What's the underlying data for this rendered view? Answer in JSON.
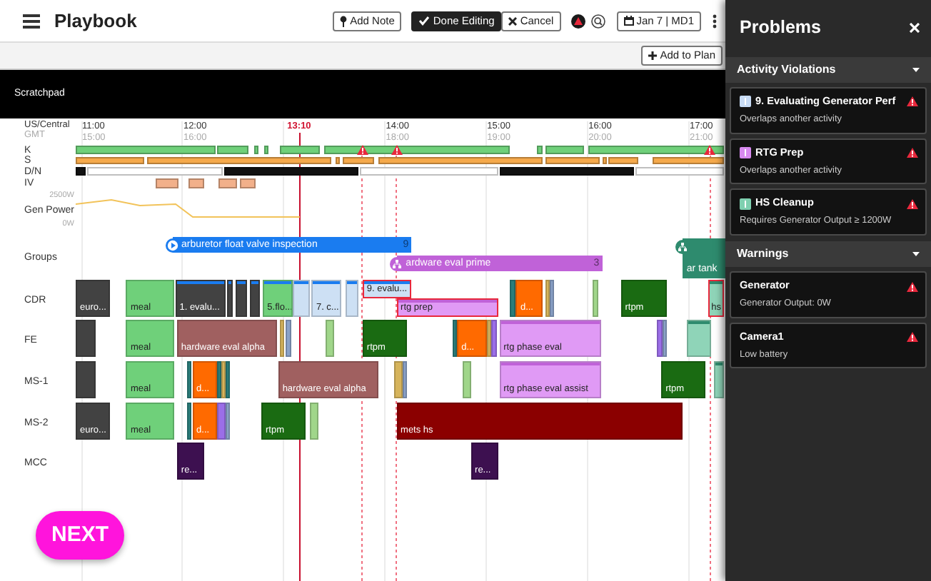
{
  "header": {
    "title": "Playbook",
    "actions": [
      {
        "kind": "note",
        "label": "Add Note"
      },
      {
        "kind": "done",
        "label": "Done Editing"
      },
      {
        "kind": "cancel",
        "label": "Cancel"
      }
    ],
    "date": "Jan 7 | MD1"
  },
  "toolbar": {
    "add_button": "Add to Plan"
  },
  "scratchpad": {
    "label": "Scratchpad"
  },
  "timeline": {
    "zones": [
      {
        "name": "US/Central",
        "ticks": [
          "11:00",
          "12:00",
          "14:00",
          "15:00",
          "16:00",
          "17:00"
        ]
      },
      {
        "name": "GMT",
        "ticks": [
          "15:00",
          "16:00",
          "18:00",
          "19:00",
          "20:00",
          "21:00"
        ]
      }
    ],
    "now": "13:10",
    "status_rows": [
      {
        "label": "K",
        "segments": [
          {
            "color": "#6fd07a"
          },
          {
            "color": "#6fd07a"
          },
          {
            "color": "#6fd07a"
          },
          {
            "color": "#6fd07a"
          },
          {
            "color": "#6fd07a"
          },
          {
            "color": "#6fd07a"
          },
          {
            "color": "#6fd07a"
          },
          {
            "color": "#6fd07a"
          },
          {
            "color": "#6fd07a"
          }
        ]
      },
      {
        "label": "S",
        "segments": [
          {
            "color": "#f5a94b"
          },
          {
            "color": "#f5a94b"
          },
          {
            "color": "#f5a94b"
          },
          {
            "color": "#f5a94b"
          },
          {
            "color": "#f5a94b"
          },
          {
            "color": "#f5a94b"
          },
          {
            "color": "#f5a94b"
          },
          {
            "color": "#f5a94b"
          },
          {
            "color": "#f5a94b"
          }
        ]
      },
      {
        "label": "D/N",
        "segments": [
          {
            "color": "#111111"
          },
          {
            "color": "#ffffff"
          },
          {
            "color": "#111111"
          },
          {
            "color": "#ffffff"
          },
          {
            "color": "#111111"
          },
          {
            "color": "#ffffff"
          }
        ]
      },
      {
        "label": "IV",
        "segments": [
          {
            "color": "#f2b08a"
          },
          {
            "color": "#f2b08a"
          },
          {
            "color": "#f2b08a"
          },
          {
            "color": "#f2b08a"
          }
        ]
      }
    ],
    "power": {
      "label": "Gen Power",
      "max": "2500W",
      "min": "0W"
    },
    "groups": {
      "label": "Groups",
      "items": [
        {
          "kind": "play",
          "label": "arburetor float valve inspection",
          "count": "9",
          "color": "#1a7cf0"
        },
        {
          "kind": "group",
          "label": "ardware eval prime",
          "count": "3",
          "color": "#c062d8"
        },
        {
          "kind": "group",
          "label": "ar tank",
          "color": "#2e8b6e"
        }
      ]
    },
    "lanes": [
      {
        "label": "CDR",
        "items": [
          {
            "color": "#424242",
            "label": "euro..."
          },
          {
            "color": "#6fd07a",
            "label": "meal"
          },
          {
            "color": "#424242",
            "label": "1. evalu...",
            "striped": true
          },
          {
            "color": "#424242",
            "striped": true
          },
          {
            "color": "#424242",
            "striped": true
          },
          {
            "color": "#424242",
            "striped": true
          },
          {
            "color": "#6fd07a",
            "label": "5.flo...",
            "striped": true
          },
          {
            "color": "#cde0f4",
            "striped": true
          },
          {
            "color": "#cde0f4",
            "label": "7. c...",
            "striped": true
          },
          {
            "color": "#cde0f4",
            "striped": true
          },
          {
            "color": "#cde0f4",
            "label": "9. evalu...",
            "striped": true,
            "flagged": true
          },
          {
            "color": "#e09af5",
            "label": "rtg prep",
            "striped": true,
            "flagged": true
          },
          {
            "color": "#2a7d7a"
          },
          {
            "color": "#ff6a00",
            "label": "d..."
          },
          {
            "color": "#d6b45c"
          },
          {
            "color": "#8aa2c8"
          },
          {
            "color": "#a0d68a"
          },
          {
            "color": "#1a6b12",
            "label": "rtpm"
          },
          {
            "color": "#8fd4b8",
            "label": "hs",
            "striped": true,
            "flagged": true
          }
        ]
      },
      {
        "label": "FE",
        "items": [
          {
            "color": "#424242"
          },
          {
            "color": "#6fd07a",
            "label": "meal"
          },
          {
            "color": "#a06060",
            "label": "hardware eval alpha"
          },
          {
            "color": "#d6b45c"
          },
          {
            "color": "#8aa2c8"
          },
          {
            "color": "#a0d68a"
          },
          {
            "color": "#1a6b12",
            "label": "rtpm"
          },
          {
            "color": "#2a7d7a"
          },
          {
            "color": "#ff6a00",
            "label": "d..."
          },
          {
            "color": "#d6b45c"
          },
          {
            "color": "#9b6ee8"
          },
          {
            "color": "#e09af5",
            "label": "rtg phase eval",
            "striped": true
          },
          {
            "color": "#9b6ee8"
          },
          {
            "color": "#8aa2c8"
          },
          {
            "color": "#8fd4b8",
            "striped": true
          }
        ]
      },
      {
        "label": "MS-1",
        "items": [
          {
            "color": "#424242"
          },
          {
            "color": "#6fd07a",
            "label": "meal"
          },
          {
            "color": "#2a7d7a"
          },
          {
            "color": "#ff6a00",
            "label": "d..."
          },
          {
            "color": "#2a7d7a"
          },
          {
            "color": "#d6b45c"
          },
          {
            "color": "#2a7d7a"
          },
          {
            "color": "#a06060",
            "label": "hardware eval alpha"
          },
          {
            "color": "#d6b45c"
          },
          {
            "color": "#8aa2c8"
          },
          {
            "color": "#a0d68a"
          },
          {
            "color": "#e09af5",
            "label": "rtg phase eval assist",
            "striped": true
          },
          {
            "color": "#1a6b12",
            "label": "rtpm"
          },
          {
            "color": "#8fd4b8",
            "striped": true
          }
        ]
      },
      {
        "label": "MS-2",
        "items": [
          {
            "color": "#424242",
            "label": "euro..."
          },
          {
            "color": "#6fd07a",
            "label": "meal"
          },
          {
            "color": "#2a7d7a"
          },
          {
            "color": "#ff6a00",
            "label": "d..."
          },
          {
            "color": "#9b6ee8"
          },
          {
            "color": "#8aa2c8"
          },
          {
            "color": "#1a6b12",
            "label": "rtpm"
          },
          {
            "color": "#a0d68a"
          },
          {
            "color": "#8b0000",
            "label": "mets hs"
          }
        ]
      },
      {
        "label": "MCC",
        "items": [
          {
            "color": "#3d1050",
            "label": "re..."
          },
          {
            "color": "#3d1050",
            "label": "re..."
          }
        ]
      }
    ]
  },
  "next_button": "NEXT",
  "problems": {
    "title": "Problems",
    "sections": [
      {
        "title": "Activity Violations",
        "expanded": true,
        "items": [
          {
            "title": "9. Evaluating Generator Perf",
            "detail": "Overlaps another activity",
            "color": "#c8dcf5"
          },
          {
            "title": "RTG Prep",
            "detail": "Overlaps another activity",
            "color": "#d88af0"
          },
          {
            "title": "HS Cleanup",
            "detail": "Requires Generator Output ≥ 1200W",
            "color": "#7fd0b0"
          }
        ]
      },
      {
        "title": "Warnings",
        "expanded": true,
        "items": [
          {
            "title": "Generator",
            "detail": "Generator Output: 0W"
          },
          {
            "title": "Camera1",
            "detail": "Low battery"
          }
        ]
      }
    ]
  }
}
